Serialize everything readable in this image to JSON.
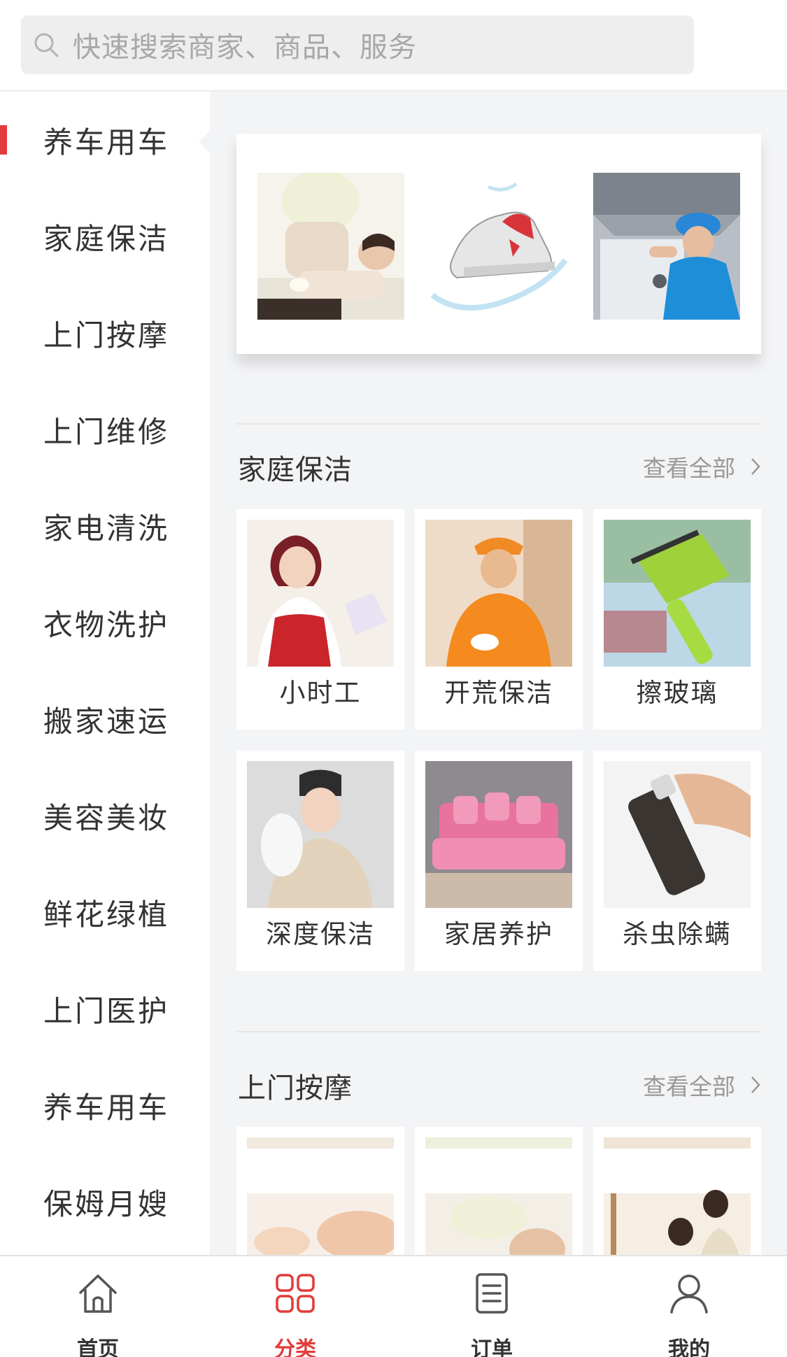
{
  "search": {
    "placeholder": "快速搜索商家、商品、服务"
  },
  "sidebar": {
    "items": [
      {
        "label": "养车用车",
        "active": true
      },
      {
        "label": "家庭保洁"
      },
      {
        "label": "上门按摩"
      },
      {
        "label": "上门维修"
      },
      {
        "label": "家电清洗"
      },
      {
        "label": "衣物洗护"
      },
      {
        "label": "搬家速运"
      },
      {
        "label": "美容美妆"
      },
      {
        "label": "鲜花绿植"
      },
      {
        "label": "上门医护"
      },
      {
        "label": "养车用车"
      },
      {
        "label": "保姆月嫂"
      }
    ]
  },
  "banner": {
    "images": [
      "massage-photo",
      "sneaker-splash-photo",
      "range-hood-repair-photo"
    ]
  },
  "sections": [
    {
      "title": "家庭保洁",
      "more": "查看全部",
      "items": [
        {
          "label": "小时工"
        },
        {
          "label": "开荒保洁"
        },
        {
          "label": "擦玻璃"
        },
        {
          "label": "深度保洁"
        },
        {
          "label": "家居养护"
        },
        {
          "label": "杀虫除螨"
        }
      ]
    },
    {
      "title": "上门按摩",
      "more": "查看全部",
      "items": []
    }
  ],
  "tabbar": {
    "items": [
      {
        "label": "首页",
        "icon": "home-icon"
      },
      {
        "label": "分类",
        "icon": "category-grid-icon",
        "active": true
      },
      {
        "label": "订单",
        "icon": "order-list-icon"
      },
      {
        "label": "我的",
        "icon": "user-icon"
      }
    ]
  },
  "colors": {
    "accent": "#e23b3b",
    "page_bg": "#f3f4f6",
    "text": "#333333",
    "muted": "#999999"
  }
}
